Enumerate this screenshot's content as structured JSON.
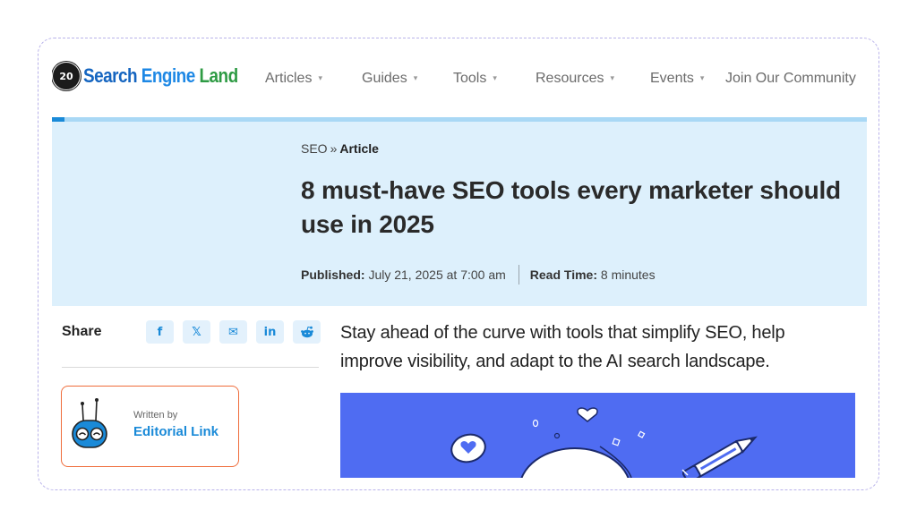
{
  "site": {
    "logo_badge": "20",
    "logo_word1": "Search",
    "logo_word2": "Engine",
    "logo_word3": "Land"
  },
  "nav": {
    "items": [
      {
        "label": "Articles",
        "has_caret": true
      },
      {
        "label": "Guides",
        "has_caret": true
      },
      {
        "label": "Tools",
        "has_caret": true
      },
      {
        "label": "Resources",
        "has_caret": true
      },
      {
        "label": "Events",
        "has_caret": true
      },
      {
        "label": "Join Our Community",
        "has_caret": false
      }
    ],
    "caret_glyph": "▾"
  },
  "breadcrumb": {
    "section": "SEO",
    "separator": "»",
    "current": "Article"
  },
  "article": {
    "title": "8 must-have SEO tools every marketer should use in 2025",
    "published_label": "Published:",
    "published_value": "July 21, 2025 at 7:00 am",
    "read_time_label": "Read Time:",
    "read_time_value": "8 minutes",
    "lede": "Stay ahead of the curve with tools that simplify SEO, help improve visibility, and adapt to the AI search landscape."
  },
  "share": {
    "label": "Share",
    "buttons": [
      {
        "icon": "facebook-icon",
        "glyph": "f"
      },
      {
        "icon": "x-icon",
        "glyph": "𝕏"
      },
      {
        "icon": "email-icon",
        "glyph": "✉"
      },
      {
        "icon": "linkedin-icon",
        "glyph": "in"
      },
      {
        "icon": "reddit-icon",
        "glyph": "●"
      }
    ]
  },
  "author": {
    "written_by": "Written by",
    "name": "Editorial Link"
  },
  "colors": {
    "accent_blue": "#1a8ad8",
    "hero_bg": "#ddf0fc",
    "author_border": "#ef6c3a",
    "hero_image_bg": "#4f6cf2"
  }
}
